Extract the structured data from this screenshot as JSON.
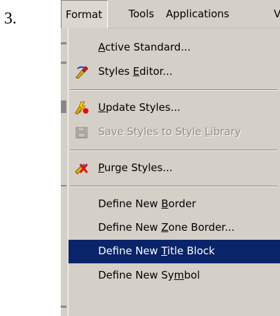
{
  "step_number": "3.",
  "menubar": {
    "items": [
      {
        "label": "Format",
        "active": true
      },
      {
        "label": "Tools"
      },
      {
        "label": "Applications"
      },
      {
        "label": "V"
      }
    ]
  },
  "menu": {
    "items": [
      {
        "pre": "",
        "key": "A",
        "post": "ctive Standard...",
        "icon": "",
        "enabled": true
      },
      {
        "pre": "Styles ",
        "key": "E",
        "post": "ditor...",
        "icon": "styles-editor-icon",
        "enabled": true
      },
      {
        "pre": "",
        "key": "U",
        "post": "pdate Styles...",
        "icon": "update-styles-icon",
        "enabled": true
      },
      {
        "pre": "Save Styles to Style ",
        "key": "L",
        "post": "ibrary",
        "icon": "save-styles-icon",
        "enabled": false
      },
      {
        "pre": "",
        "key": "P",
        "post": "urge Styles...",
        "icon": "purge-styles-icon",
        "enabled": true
      },
      {
        "pre": "Define New ",
        "key": "B",
        "post": "order",
        "icon": "",
        "enabled": true
      },
      {
        "pre": "Define New ",
        "key": "Z",
        "post": "one Border...",
        "icon": "",
        "enabled": true
      },
      {
        "pre": "Define New ",
        "key": "T",
        "post": "itle Block",
        "icon": "",
        "enabled": true,
        "highlighted": true
      },
      {
        "pre": "Define New Sy",
        "key": "m",
        "post": "bol",
        "icon": "",
        "enabled": true
      }
    ]
  },
  "colors": {
    "menu_bg": "#d4d0c8",
    "highlight": "#0a246a",
    "disabled_text": "#8f8c87"
  }
}
